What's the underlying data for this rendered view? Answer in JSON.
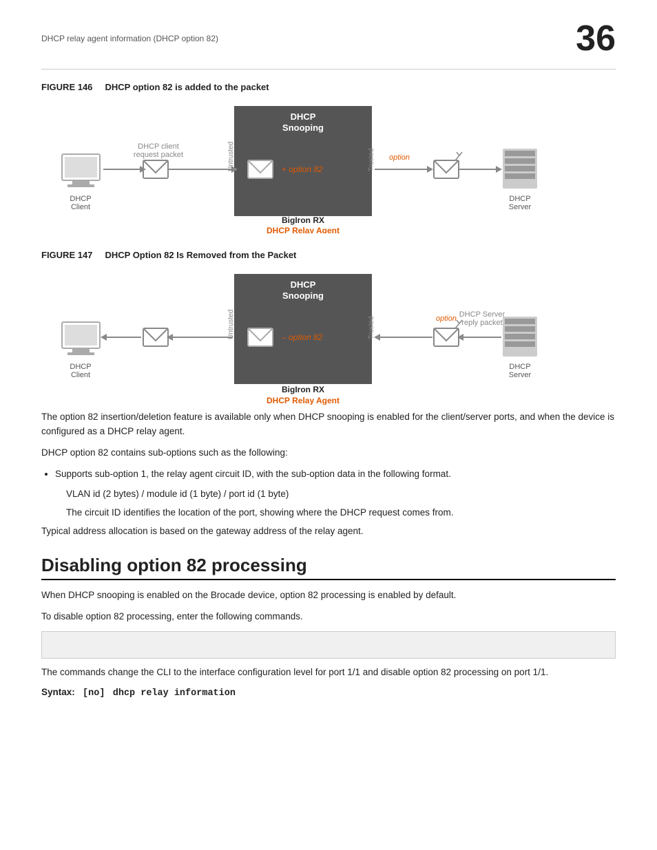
{
  "header": {
    "title": "DHCP relay agent information (DHCP option 82)",
    "chapter_number": "36"
  },
  "figure146": {
    "label": "FIGURE 146",
    "description": "DHCP option 82 is added to the packet",
    "snooping_title": "DHCP\nSnooping",
    "bigiron_label": "BigIron RX",
    "relay_agent_label": "DHCP Relay Agent",
    "untrusted_label": "Untrusted",
    "trusted_label": "Trusted",
    "dhcp_client_label": "DHCP\nClient",
    "dhcp_server_label": "DHCP\nServer",
    "request_packet_label": "DHCP client\nrequest packet",
    "option_label": "option",
    "option82_text": "+ option 82"
  },
  "figure147": {
    "label": "FIGURE 147",
    "description": "DHCP Option 82 Is Removed from the Packet",
    "snooping_title": "DHCP\nSnooping",
    "bigiron_label": "BigIron RX",
    "relay_agent_label": "DHCP Relay Agent",
    "untrusted_label": "Untrusted",
    "trusted_label": "Trusted",
    "dhcp_client_label": "DHCP\nClient",
    "dhcp_server_label": "DHCP\nServer",
    "reply_packet_label": "DHCP Server\nreply packet",
    "option_label": "option",
    "option82_text": "– option 82"
  },
  "body": {
    "para1": "The option 82 insertion/deletion feature is available only when DHCP snooping is enabled for the client/server ports, and when the device is configured as a DHCP relay agent.",
    "para2": "DHCP option 82 contains sub-options such as the following:",
    "bullet1": "Supports sub-option 1, the relay agent circuit ID, with the sub-option data in the following format.",
    "indent1": "VLAN id (2 bytes) /  module id (1 byte) / port id (1 byte)",
    "indent2": "The circuit ID identifies the location of the port, showing where the DHCP request comes from.",
    "para3": "Typical address allocation is based on the gateway address of the relay agent.",
    "section_heading": "Disabling option 82 processing",
    "para4": "When DHCP snooping is enabled on the Brocade device, option 82 processing is enabled by default.",
    "para5": "To disable option 82 processing, enter the following commands.",
    "para6": "The commands change the CLI to the interface configuration level for port 1/1 and disable option 82 processing on port 1/1.",
    "syntax_label": "Syntax:",
    "syntax_optional": "[no]",
    "syntax_command": "dhcp relay information"
  }
}
